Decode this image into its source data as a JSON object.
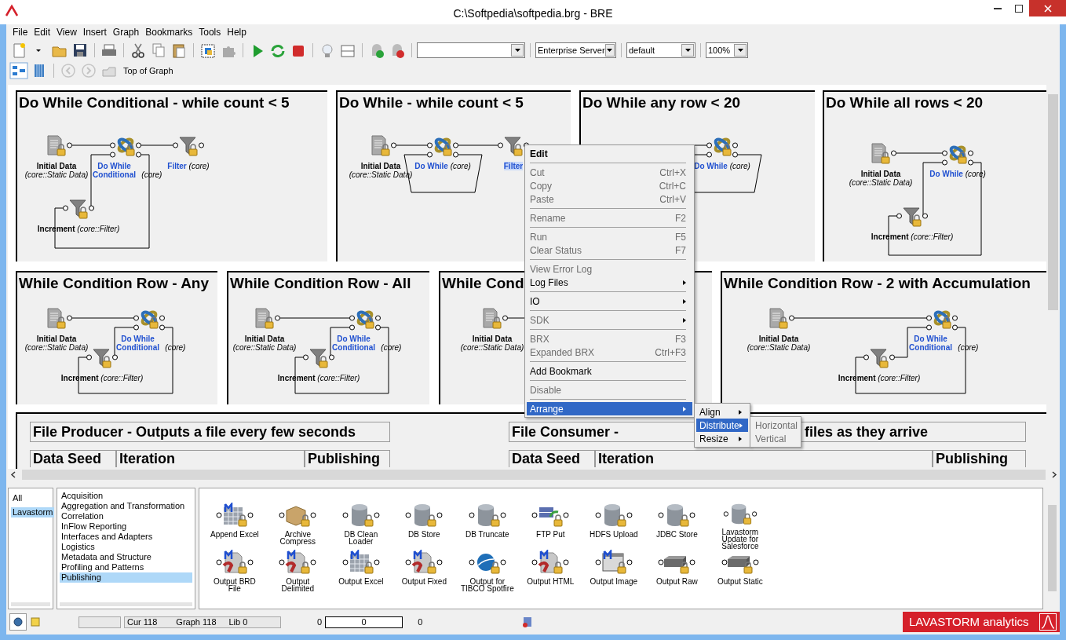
{
  "window": {
    "title": "C:\\Softpedia\\softpedia.brg - BRE"
  },
  "menu_bar": [
    {
      "label": "File"
    },
    {
      "label": "Edit"
    },
    {
      "label": "View"
    },
    {
      "label": "Insert"
    },
    {
      "label": "Graph"
    },
    {
      "label": "Bookmarks"
    },
    {
      "label": "Tools"
    },
    {
      "label": "Help"
    }
  ],
  "toolbar": {
    "combos": [
      {
        "value": "Enterprise Server"
      },
      {
        "value": "default"
      },
      {
        "value": "100%"
      }
    ]
  },
  "navigation": {
    "back": {
      "disabled": true
    },
    "forward": {
      "disabled": true
    },
    "location": "Top of Graph"
  },
  "graph": {
    "panels": [
      {
        "title": "Do While Conditional - while count < 5",
        "nodes": [
          {
            "kind": "data",
            "name": "Initial Data",
            "type": "(core::Static Data)",
            "library_node": false,
            "selected": false
          },
          {
            "kind": "loop",
            "name": "Do While Conditional",
            "type": "(core)",
            "library_node": true,
            "selected": false
          },
          {
            "kind": "filter",
            "name": "Filter",
            "type": "(core)",
            "library_node": true,
            "selected": false
          },
          {
            "kind": "increment",
            "name": "Increment",
            "type": "(core::Filter)",
            "library_node": false,
            "selected": false
          }
        ]
      },
      {
        "title": "Do While - while count < 5",
        "nodes": [
          {
            "kind": "data",
            "name": "Initial Data",
            "type": "(core::Static Data)",
            "library_node": false,
            "selected": false
          },
          {
            "kind": "loop",
            "name": "Do While",
            "type": "(core)",
            "library_node": true,
            "selected": false
          },
          {
            "kind": "filter",
            "name": "Filter",
            "library_node": true,
            "selected": true
          }
        ]
      },
      {
        "title": "Do While any row < 20",
        "nodes": [
          {
            "kind": "loop",
            "name": "Do While",
            "type": "(core)",
            "library_node": true,
            "selected": false
          }
        ]
      },
      {
        "title": "Do While all rows < 20",
        "nodes": [
          {
            "kind": "data",
            "name": "Initial Data",
            "type": "(core::Static Data)",
            "library_node": false,
            "selected": false
          },
          {
            "kind": "loop",
            "name": "Do While",
            "type": "(core)",
            "library_node": true,
            "selected": false
          },
          {
            "kind": "increment",
            "name": "Increment",
            "type": "(core::Filter)",
            "library_node": false,
            "selected": false
          }
        ]
      },
      {
        "title": "While Condition Row - Any",
        "nodes": [
          {
            "kind": "data",
            "name": "Initial Data",
            "type": "(core::Static Data)",
            "library_node": false,
            "selected": false
          },
          {
            "kind": "loop",
            "name": "Do While Conditional",
            "type": "(core)",
            "library_node": true,
            "selected": false
          },
          {
            "kind": "increment",
            "name": "Increment",
            "type": "(core::Filter)",
            "library_node": false,
            "selected": false
          }
        ]
      },
      {
        "title": "While Condition Row - All",
        "nodes": [
          {
            "kind": "data",
            "name": "Initial Data",
            "type": "(core::Static Data)",
            "library_node": false,
            "selected": false
          },
          {
            "kind": "loop",
            "name": "Do While Conditional",
            "type": "(core)",
            "library_node": true,
            "selected": false
          },
          {
            "kind": "increment",
            "name": "Increment",
            "type": "(core::Filter)",
            "library_node": false,
            "selected": false
          }
        ]
      },
      {
        "title": "While Cond",
        "nodes": [
          {
            "kind": "data",
            "name": "Initial Data",
            "type": "(core::Static Data)",
            "library_node": false,
            "selected": false
          }
        ]
      },
      {
        "title": "While Condition Row - 2 with Accumulation",
        "nodes": [
          {
            "kind": "data",
            "name": "Initial Data",
            "type": "(core::Static Data)",
            "library_node": false,
            "selected": false
          },
          {
            "kind": "loop",
            "name": "Do While Conditional",
            "type": "(core)",
            "library_node": true,
            "selected": false
          },
          {
            "kind": "increment",
            "name": "Increment",
            "type": "(core::Filter)",
            "library_node": false,
            "selected": false
          }
        ]
      }
    ],
    "groups": [
      {
        "title": "File Producer - Outputs a file every few seconds",
        "sections": [
          "Data Seed",
          "Iteration",
          "Publishing"
        ]
      },
      {
        "title": "File Consumer -",
        "title_tail": "files as they arrive",
        "sections": [
          "Data Seed",
          "Iteration",
          "Publishing"
        ]
      }
    ]
  },
  "context_menu": {
    "groups": [
      [
        {
          "label": "Edit",
          "default": true,
          "disabled": false,
          "submenu": false,
          "selected": false
        }
      ],
      [
        {
          "label": "Cut",
          "shortcut": "Ctrl+X",
          "default": false,
          "disabled": true,
          "submenu": false,
          "selected": false
        },
        {
          "label": "Copy",
          "shortcut": "Ctrl+C",
          "default": false,
          "disabled": true,
          "submenu": false,
          "selected": false
        },
        {
          "label": "Paste",
          "shortcut": "Ctrl+V",
          "default": false,
          "disabled": true,
          "submenu": false,
          "selected": false
        }
      ],
      [
        {
          "label": "Rename",
          "shortcut": "F2",
          "default": false,
          "disabled": true,
          "submenu": false,
          "selected": false
        }
      ],
      [
        {
          "label": "Run",
          "shortcut": "F5",
          "default": false,
          "disabled": true,
          "submenu": false,
          "selected": false
        },
        {
          "label": "Clear Status",
          "shortcut": "F7",
          "default": false,
          "disabled": true,
          "submenu": false,
          "selected": false
        }
      ],
      [
        {
          "label": "View Error Log",
          "default": false,
          "disabled": true,
          "submenu": false,
          "selected": false
        },
        {
          "label": "Log Files",
          "default": false,
          "disabled": false,
          "submenu": true,
          "selected": false
        }
      ],
      [
        {
          "label": "IO",
          "default": false,
          "disabled": false,
          "submenu": true,
          "selected": false
        }
      ],
      [
        {
          "label": "SDK",
          "default": false,
          "disabled": true,
          "submenu": true,
          "selected": false
        }
      ],
      [
        {
          "label": "BRX",
          "shortcut": "F3",
          "default": false,
          "disabled": true,
          "submenu": false,
          "selected": false
        },
        {
          "label": "Expanded BRX",
          "shortcut": "Ctrl+F3",
          "default": false,
          "disabled": true,
          "submenu": false,
          "selected": false
        }
      ],
      [
        {
          "label": "Add Bookmark",
          "default": false,
          "disabled": false,
          "submenu": false,
          "selected": false
        }
      ],
      [
        {
          "label": "Disable",
          "default": false,
          "disabled": true,
          "submenu": false,
          "selected": false
        }
      ],
      [
        {
          "label": "Arrange",
          "default": false,
          "disabled": false,
          "submenu": true,
          "selected": true
        }
      ]
    ]
  },
  "arrange_menu": [
    {
      "label": "Align",
      "selected": false
    },
    {
      "label": "Distribute",
      "selected": true
    },
    {
      "label": "Resize",
      "selected": false
    }
  ],
  "distribute_menu": [
    {
      "label": "Horizontal",
      "disabled": true
    },
    {
      "label": "Vertical",
      "disabled": true
    }
  ],
  "library": {
    "filters": [
      {
        "label": "All",
        "selected": false
      },
      {
        "label": "Lavastorm",
        "selected": true
      }
    ],
    "categories": [
      {
        "label": "Acquisition",
        "selected": false
      },
      {
        "label": "Aggregation and Transformation",
        "selected": false
      },
      {
        "label": "Correlation",
        "selected": false
      },
      {
        "label": "InFlow Reporting",
        "selected": false
      },
      {
        "label": "Interfaces and Adapters",
        "selected": false
      },
      {
        "label": "Logistics",
        "selected": false
      },
      {
        "label": "Metadata and Structure",
        "selected": false
      },
      {
        "label": "Profiling and Patterns",
        "selected": false
      },
      {
        "label": "Publishing",
        "selected": true
      }
    ],
    "nodes": [
      {
        "label": "Append Excel",
        "kind": "spreadsheet"
      },
      {
        "label": "Archive Compress",
        "kind": "box"
      },
      {
        "label": "DB Clean Loader",
        "kind": "database"
      },
      {
        "label": "DB Store",
        "kind": "database"
      },
      {
        "label": "DB Truncate",
        "kind": "database"
      },
      {
        "label": "FTP Put",
        "kind": "server"
      },
      {
        "label": "HDFS Upload",
        "kind": "database"
      },
      {
        "label": "JDBC Store",
        "kind": "database"
      },
      {
        "label": "Lavastorm Update for Salesforce",
        "kind": "database"
      },
      {
        "label": "Output BRD File",
        "kind": "document"
      },
      {
        "label": "Output Delimited",
        "kind": "document"
      },
      {
        "label": "Output Excel",
        "kind": "spreadsheet"
      },
      {
        "label": "Output Fixed",
        "kind": "document"
      },
      {
        "label": "Output for TIBCO Spotfire",
        "kind": "globe"
      },
      {
        "label": "Output HTML",
        "kind": "document"
      },
      {
        "label": "Output Image",
        "kind": "window"
      },
      {
        "label": "Output Raw",
        "kind": "drive"
      },
      {
        "label": "Output Static",
        "kind": "drive"
      }
    ]
  },
  "status_bar": {
    "cur": "Cur 118",
    "graph": "Graph 118",
    "lib": "Lib 0",
    "left_count": "0",
    "progress": "0",
    "right_count": "0",
    "brand": "LAVASTORM analytics"
  }
}
